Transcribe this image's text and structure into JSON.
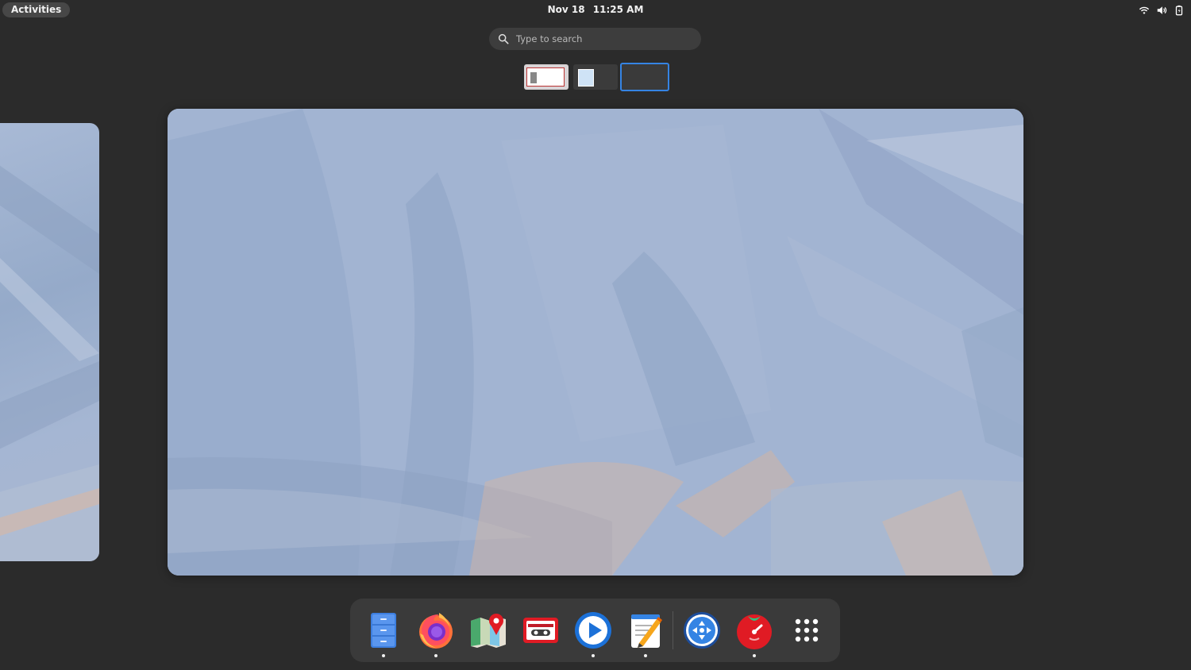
{
  "topbar": {
    "activities_label": "Activities",
    "date": "Nov 18",
    "time": "11:25 AM",
    "status_icons": [
      "wifi-icon",
      "volume-icon",
      "battery-icon"
    ]
  },
  "search": {
    "placeholder": "Type to search"
  },
  "workspaces": {
    "thumbnails": [
      "workspace-1",
      "workspace-2",
      "workspace-3"
    ],
    "active_index": 2
  },
  "dash": {
    "apps": [
      {
        "name": "Files",
        "icon": "files-icon",
        "running": true
      },
      {
        "name": "Firefox",
        "icon": "firefox-icon",
        "running": true
      },
      {
        "name": "Maps",
        "icon": "maps-icon",
        "running": false
      },
      {
        "name": "Podcasts",
        "icon": "cassette-icon",
        "running": false
      },
      {
        "name": "Videos",
        "icon": "play-icon",
        "running": true
      },
      {
        "name": "Text Editor",
        "icon": "text-editor-icon",
        "running": true
      },
      {
        "name": "Connections",
        "icon": "remote-desktop-icon",
        "running": false
      },
      {
        "name": "Pomodoro",
        "icon": "tomato-timer-icon",
        "running": true
      },
      {
        "name": "Show Applications",
        "icon": "app-grid-icon",
        "running": false
      }
    ]
  },
  "colors": {
    "background": "#2b2b2b",
    "accent": "#3584e4",
    "panel": "#3a3a3a"
  }
}
